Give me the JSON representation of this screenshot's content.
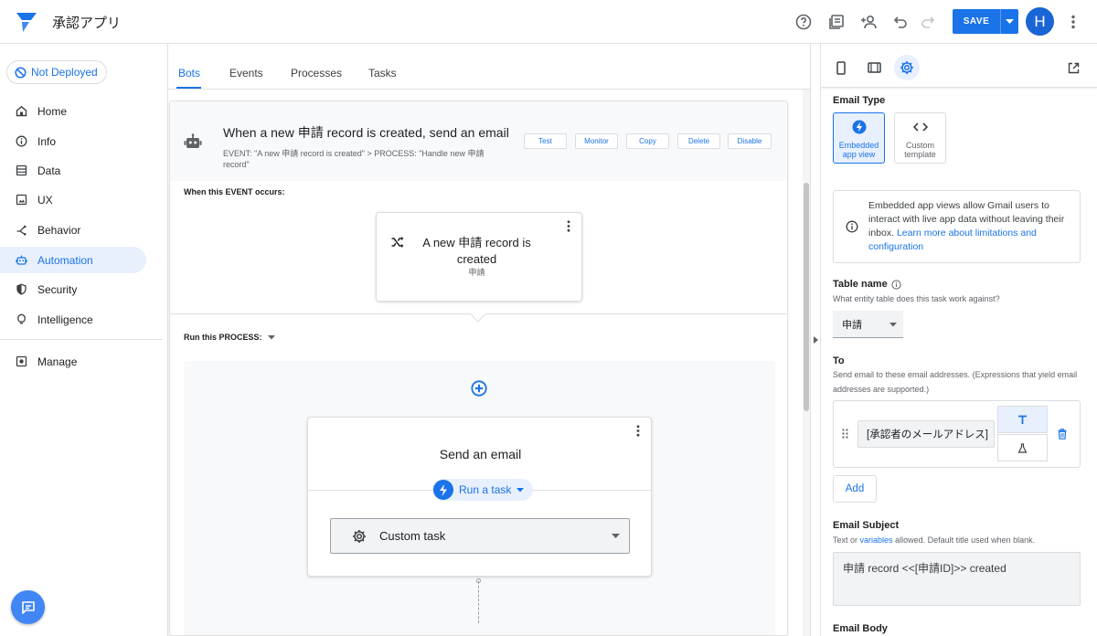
{
  "app": {
    "title": "承認アプリ"
  },
  "toolbar": {
    "save_label": "SAVE",
    "avatar_initial": "H"
  },
  "deploy": {
    "label": "Not Deployed"
  },
  "nav": {
    "items": [
      {
        "label": "Home",
        "icon": "home-icon"
      },
      {
        "label": "Info",
        "icon": "info-icon"
      },
      {
        "label": "Data",
        "icon": "data-icon"
      },
      {
        "label": "UX",
        "icon": "ux-icon"
      },
      {
        "label": "Behavior",
        "icon": "behavior-icon"
      },
      {
        "label": "Automation",
        "icon": "robot-icon",
        "active": true
      },
      {
        "label": "Security",
        "icon": "shield-icon"
      },
      {
        "label": "Intelligence",
        "icon": "lightbulb-icon"
      },
      {
        "label": "Manage",
        "icon": "manage-icon"
      }
    ]
  },
  "tabs": [
    {
      "label": "Bots",
      "active": true
    },
    {
      "label": "Events"
    },
    {
      "label": "Processes"
    },
    {
      "label": "Tasks"
    }
  ],
  "bot": {
    "title": "When a new 申請 record is created, send an email",
    "subtitle": "EVENT: \"A new 申請 record is created\" > PROCESS: \"Handle new 申請 record\"",
    "actions": [
      "Test",
      "Monitor",
      "Copy",
      "Delete",
      "Disable"
    ],
    "event_label": "When this EVENT occurs:",
    "event_title": "A new 申請 record is created",
    "event_table": "申請",
    "process_label": "Run this PROCESS:",
    "step_title": "Send an email",
    "step_type": "Run a task",
    "task_select": "Custom task"
  },
  "panel": {
    "email_type_label": "Email Type",
    "email_types": [
      {
        "label": "Embedded app view",
        "selected": true
      },
      {
        "label": "Custom template",
        "selected": false
      }
    ],
    "info_text": "Embedded app views allow Gmail users to interact with live app data without leaving their inbox.",
    "info_link": "Learn more about limitations and configuration",
    "table_label": "Table name",
    "table_hint": "What entity table does this task work against?",
    "table_value": "申請",
    "to_label": "To",
    "to_hint": "Send email to these email addresses. (Expressions that yield email addresses are supported.)",
    "to_value": "[承認者のメールアドレス]",
    "add_label": "Add",
    "subject_label": "Email Subject",
    "subject_hint_pre": "Text or",
    "subject_hint_link": "variables",
    "subject_hint_post": "allowed. Default title used when blank.",
    "subject_value": "申請 record <<[申請ID]>> created",
    "body_label": "Email Body"
  },
  "colors": {
    "accent": "#1a73e8",
    "active_bg": "#e8f0fe"
  }
}
